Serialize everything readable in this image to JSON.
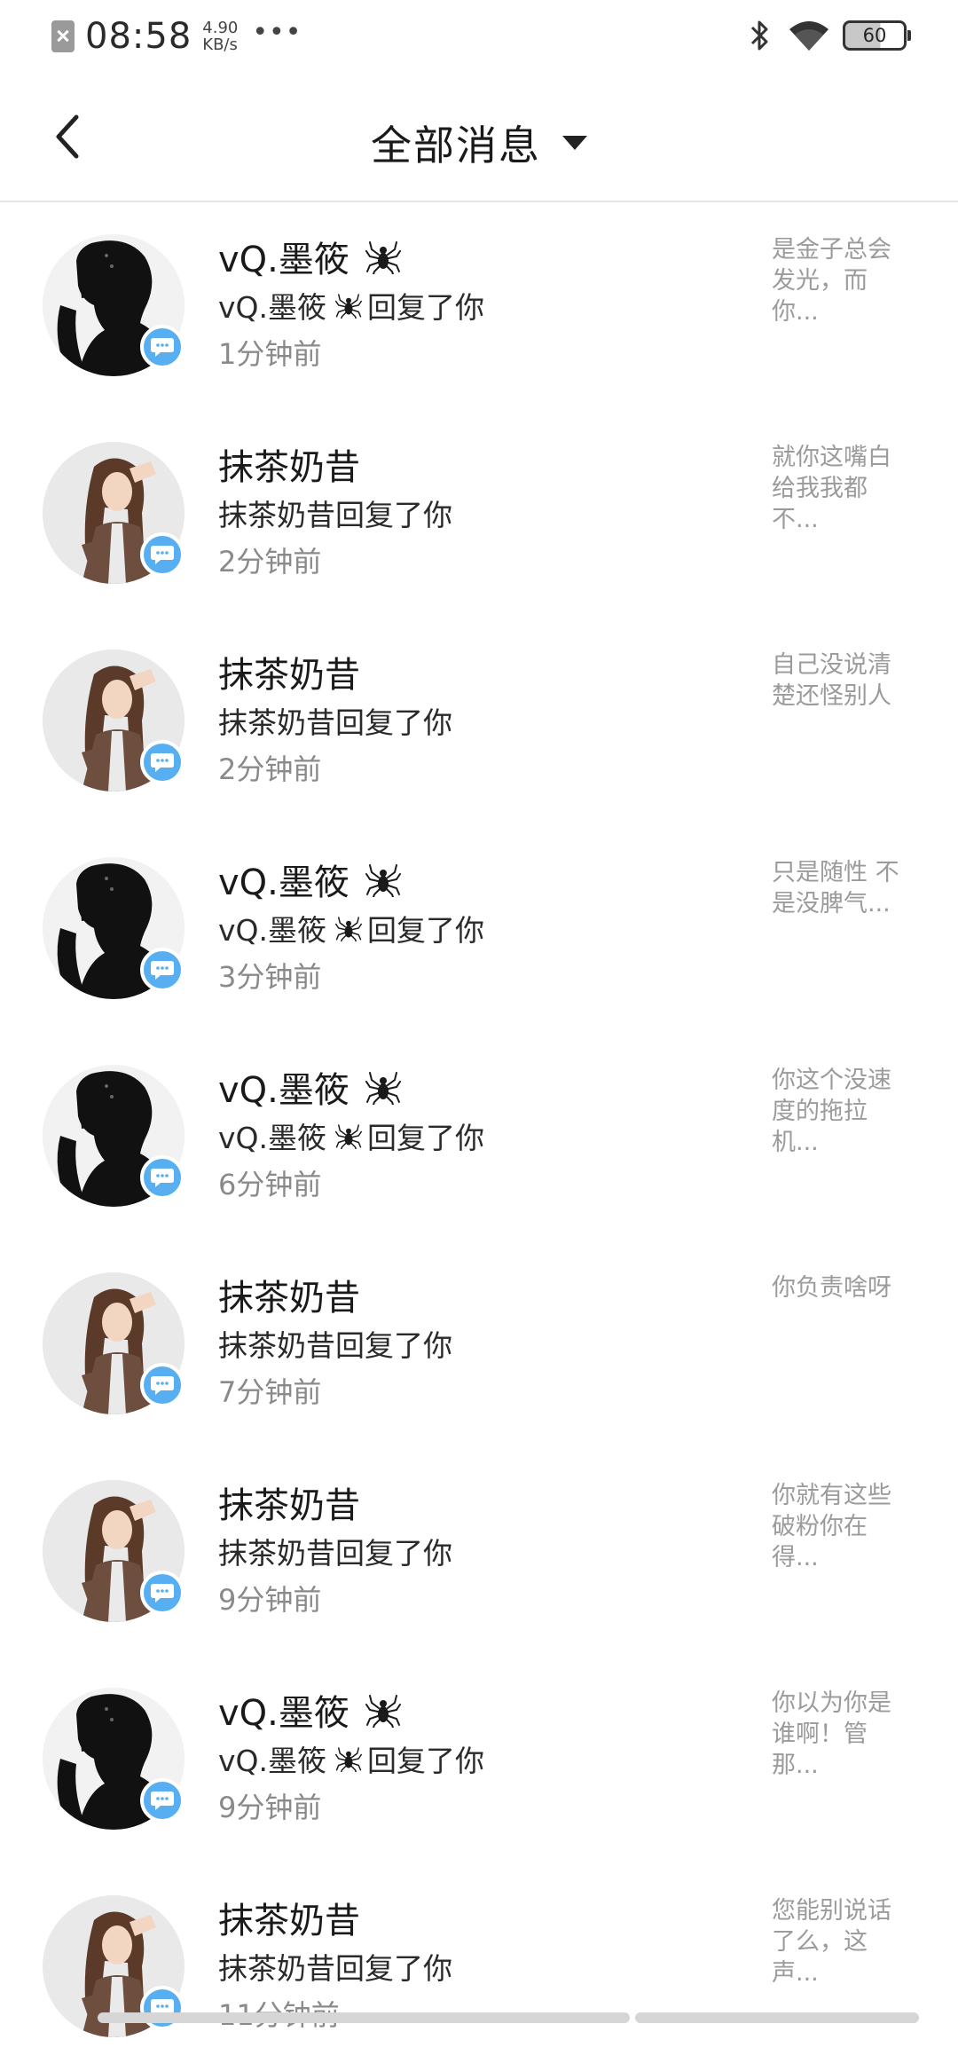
{
  "status_bar": {
    "time": "08:58",
    "speed_value": "4.90",
    "speed_unit": "KB/s",
    "dots": "•••",
    "battery": "60"
  },
  "header": {
    "title": "全部消息"
  },
  "messages": [
    {
      "name": "vQ.墨筱",
      "avatar": "silhouette",
      "spider": true,
      "subtitle_name": "vQ.墨筱",
      "subtitle_suffix": "回复了你",
      "time": "1分钟前",
      "preview": "是金子总会发光，而你..."
    },
    {
      "name": "抹茶奶昔",
      "avatar": "girl",
      "spider": false,
      "subtitle_name": "抹茶奶昔",
      "subtitle_suffix": "回复了你",
      "time": "2分钟前",
      "preview": "就你这嘴白给我我都不..."
    },
    {
      "name": "抹茶奶昔",
      "avatar": "girl",
      "spider": false,
      "subtitle_name": "抹茶奶昔",
      "subtitle_suffix": "回复了你",
      "time": "2分钟前",
      "preview": "自己没说清楚还怪别人"
    },
    {
      "name": "vQ.墨筱",
      "avatar": "silhouette",
      "spider": true,
      "subtitle_name": "vQ.墨筱",
      "subtitle_suffix": "回复了你",
      "time": "3分钟前",
      "preview": "只是随性 不是没脾气..."
    },
    {
      "name": "vQ.墨筱",
      "avatar": "silhouette",
      "spider": true,
      "subtitle_name": "vQ.墨筱",
      "subtitle_suffix": "回复了你",
      "time": "6分钟前",
      "preview": "你这个没速度的拖拉机..."
    },
    {
      "name": "抹茶奶昔",
      "avatar": "girl",
      "spider": false,
      "subtitle_name": "抹茶奶昔",
      "subtitle_suffix": "回复了你",
      "time": "7分钟前",
      "preview": "你负责啥呀"
    },
    {
      "name": "抹茶奶昔",
      "avatar": "girl",
      "spider": false,
      "subtitle_name": "抹茶奶昔",
      "subtitle_suffix": "回复了你",
      "time": "9分钟前",
      "preview": "你就有这些破粉你在得..."
    },
    {
      "name": "vQ.墨筱",
      "avatar": "silhouette",
      "spider": true,
      "subtitle_name": "vQ.墨筱",
      "subtitle_suffix": "回复了你",
      "time": "9分钟前",
      "preview": "你以为你是谁啊！管那..."
    },
    {
      "name": "抹茶奶昔",
      "avatar": "girl",
      "spider": false,
      "subtitle_name": "抹茶奶昔",
      "subtitle_suffix": "回复了你",
      "time": "11分钟前",
      "preview": "您能别说话了么，这声..."
    }
  ],
  "colors": {
    "badge": "#57aef0",
    "time_text": "#8a8a8a",
    "preview_text": "#9b9b9b"
  }
}
